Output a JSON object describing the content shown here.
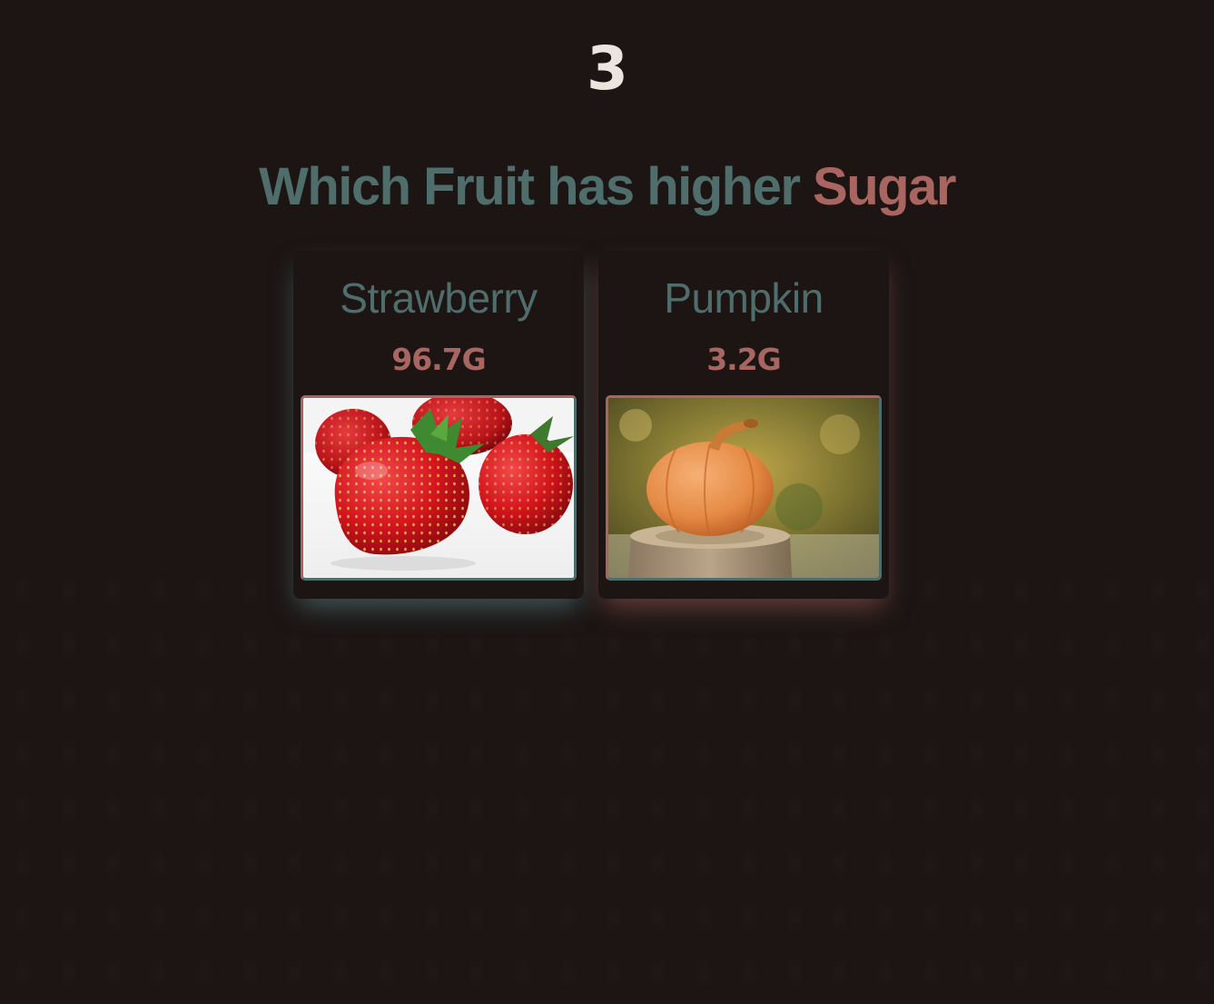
{
  "round": {
    "number": "3"
  },
  "question": {
    "prefix": "Which Fruit has higher",
    "highlight": "Sugar"
  },
  "options": [
    {
      "name": "Strawberry",
      "value": "96.7G",
      "image": "strawberry-photo"
    },
    {
      "name": "Pumpkin",
      "value": "3.2G",
      "image": "pumpkin-photo"
    }
  ],
  "colors": {
    "background": "#1c1514",
    "teal": "#4e6d6b",
    "rose": "#a96660",
    "round_number": "#ebe4df"
  }
}
